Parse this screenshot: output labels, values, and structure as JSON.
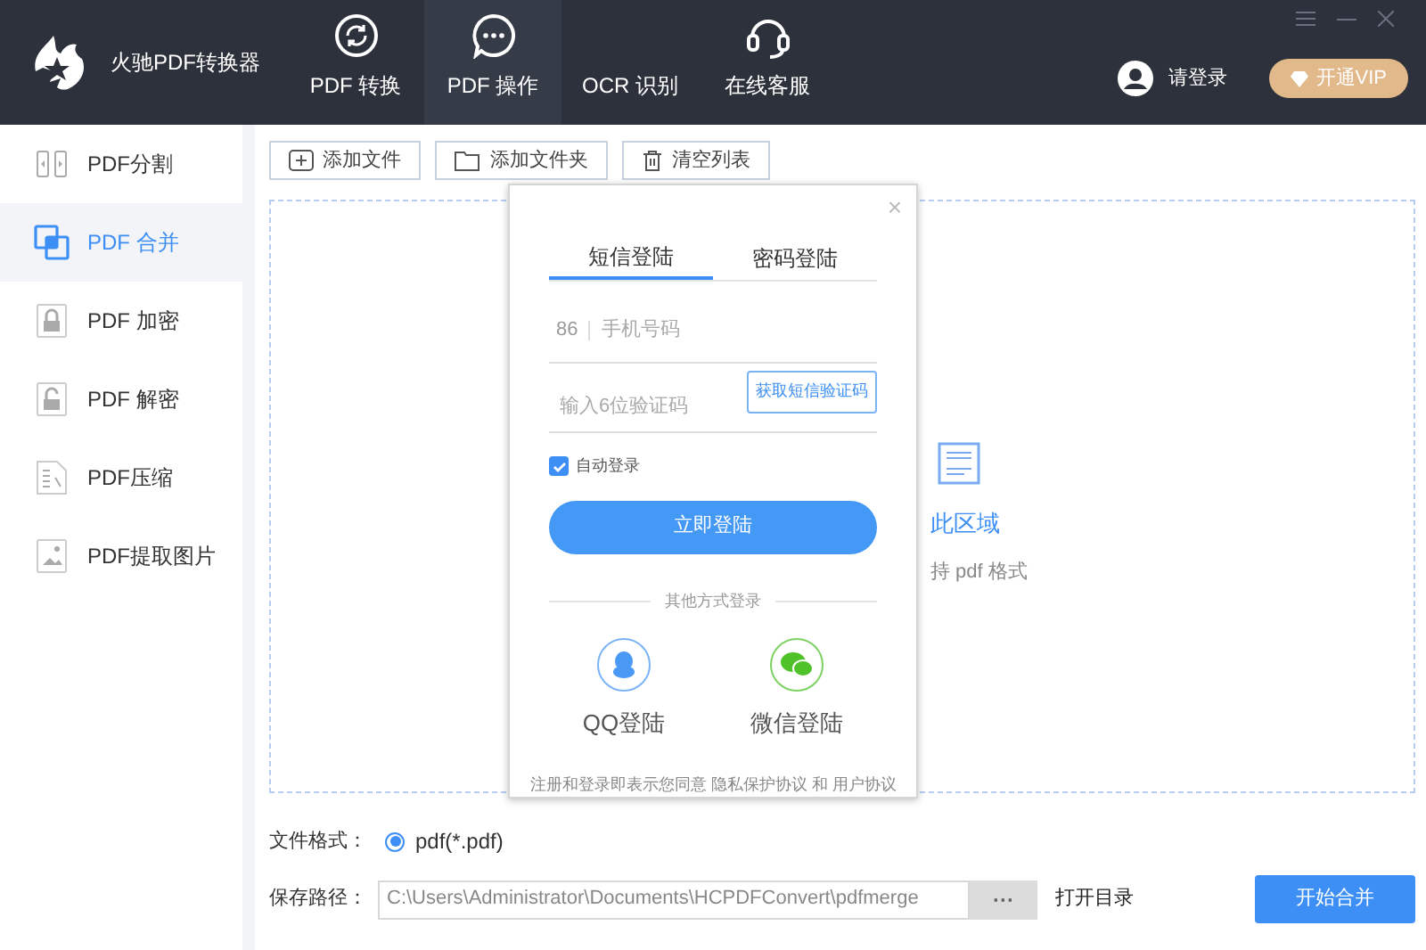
{
  "app": {
    "title": "火驰PDF转换器"
  },
  "nav": [
    {
      "label": "PDF 转换",
      "selected": false
    },
    {
      "label": "PDF 操作",
      "selected": true
    },
    {
      "label": "OCR 识别",
      "selected": false
    },
    {
      "label": "在线客服",
      "selected": false
    }
  ],
  "user": {
    "login": "请登录",
    "vip": "开通VIP"
  },
  "sidebar": [
    {
      "label": "PDF分割",
      "selected": false
    },
    {
      "label": "PDF 合并",
      "selected": true
    },
    {
      "label": "PDF 加密",
      "selected": false
    },
    {
      "label": "PDF 解密",
      "selected": false
    },
    {
      "label": "PDF压缩",
      "selected": false
    },
    {
      "label": "PDF提取图片",
      "selected": false
    }
  ],
  "toolbar": [
    "添加文件",
    "添加文件夹",
    "清空列表"
  ],
  "drop_zone": {
    "title": "此区域",
    "hint": "持 pdf 格式"
  },
  "format": {
    "label": "文件格式：",
    "option": "pdf(*.pdf)",
    "selected": true
  },
  "save": {
    "label": "保存路径：",
    "value": "C:\\Users\\Administrator\\Documents\\HCPDFConvert\\pdfmerge",
    "browse": "···",
    "open": "打开目录"
  },
  "start_button": "开始合并",
  "login": {
    "close": "×",
    "tabs": [
      {
        "label": "短信登陆",
        "selected": true
      },
      {
        "label": "密码登陆",
        "selected": false
      }
    ],
    "country_code": "86",
    "phone_placeholder": "手机号码",
    "code_placeholder": "输入6位验证码",
    "get_code": "获取短信验证码",
    "auto_login": {
      "label": "自动登录",
      "checked": true
    },
    "submit": "立即登陆",
    "other": "其他方式登录",
    "providers": [
      {
        "label": "QQ登陆",
        "kind": "qq"
      },
      {
        "label": "微信登陆",
        "kind": "wechat"
      }
    ],
    "agreement": "注册和登录即表示您同意 隐私保护协议 和 用户协议"
  }
}
